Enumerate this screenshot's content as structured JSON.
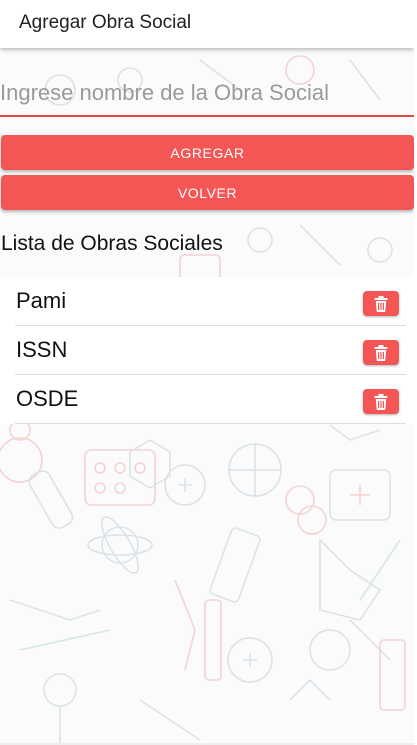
{
  "header": {
    "title": "Agregar Obra Social"
  },
  "form": {
    "placeholder": "Ingrese nombre de la Obra Social",
    "value": "",
    "add_label": "AGREGAR",
    "back_label": "VOLVER"
  },
  "list": {
    "title": "Lista de Obras Sociales",
    "items": [
      {
        "label": "Pami"
      },
      {
        "label": "ISSN"
      },
      {
        "label": "OSDE"
      }
    ]
  },
  "colors": {
    "accent": "#f45656",
    "input_underline": "#e24a47"
  },
  "icons": {
    "delete": "trash-icon"
  }
}
